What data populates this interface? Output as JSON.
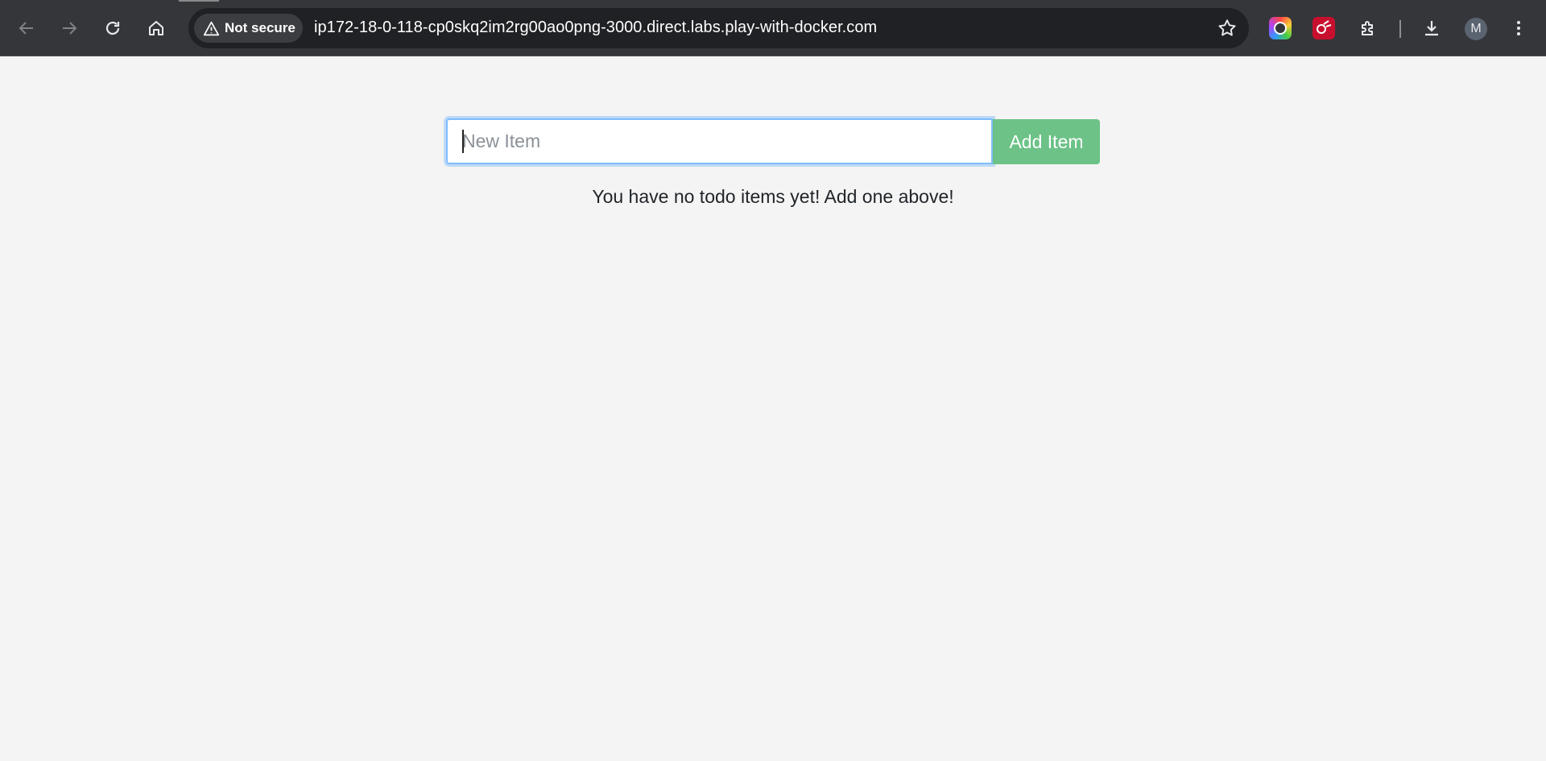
{
  "browser": {
    "security_label": "Not secure",
    "url": "ip172-18-0-118-cp0skq2im2rg00ao0png-3000.direct.labs.play-with-docker.com",
    "profile_initial": "M",
    "icons": [
      "back-arrow-icon",
      "forward-arrow-icon",
      "reload-icon",
      "home-icon",
      "warning-icon",
      "star-icon",
      "extensions-puzzle-icon",
      "download-icon",
      "more-vert-icon"
    ]
  },
  "todo": {
    "input_placeholder": "New Item",
    "input_value": "",
    "add_button_label": "Add Item",
    "empty_message": "You have no todo items yet! Add one above!"
  },
  "colors": {
    "toolbar_bg": "#35363a",
    "page_bg": "#f4f4f4",
    "add_button": "#6cc287",
    "focus_border": "#80bdff"
  }
}
